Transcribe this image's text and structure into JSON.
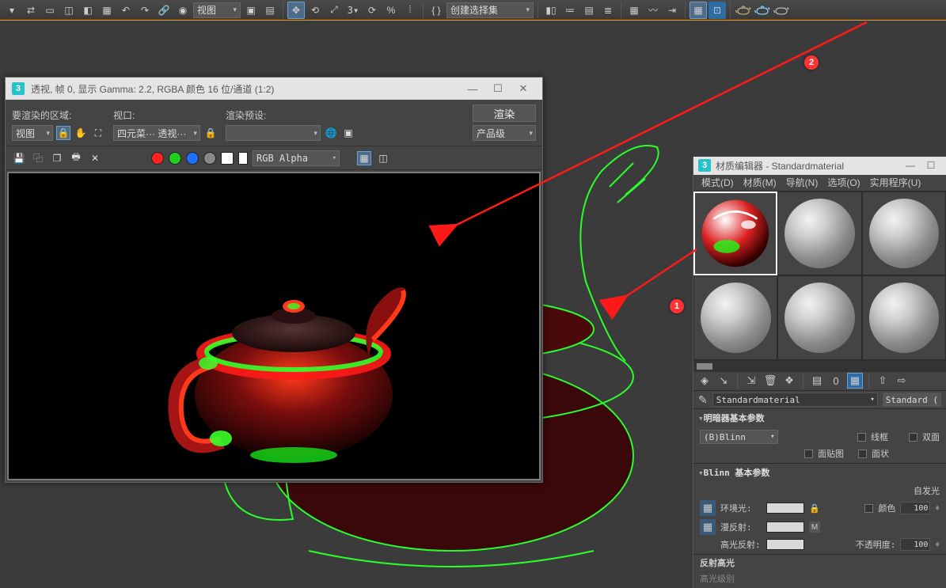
{
  "toolbar": {
    "view_combo": "视图",
    "selset_combo": "创建选择集"
  },
  "render_window": {
    "title": "透视, 帧 0, 显示 Gamma: 2.2, RGBA 颜色 16 位/通道 (1:2)",
    "area_label": "要渲染的区域:",
    "area_value": "视图",
    "viewport_label": "视口:",
    "viewport_value": "四元菜··· 透视···",
    "preset_label": "渲染预设:",
    "preset_value": "",
    "render_btn": "渲染",
    "production": "产品级",
    "rgba": "RGB Alpha"
  },
  "material_editor": {
    "title": "材质编辑器 - Standardmaterial",
    "menu": {
      "mode": "模式(D)",
      "material": "材质(M)",
      "nav": "导航(N)",
      "options": "选项(O)",
      "util": "实用程序(U)"
    },
    "material_name": "Standardmaterial",
    "material_type": "Standard (",
    "rollout_shader": "明暗器基本参数",
    "shader_value": "(B)Blinn",
    "chk_wire": "线框",
    "chk_2side": "双面",
    "chk_facemap": "面贴图",
    "chk_faceted": "面状",
    "rollout_blinn": "Blinn 基本参数",
    "selfillum_label": "自发光",
    "color_label": "颜色",
    "ambient": "环境光:",
    "diffuse": "漫反射:",
    "specular": "高光反射:",
    "opacity": "不透明度:",
    "value_100": "100",
    "rollout_spec": "反射高光",
    "spec_level_partial": "高光级别"
  },
  "annotations": {
    "n1": "1",
    "n2": "2"
  }
}
